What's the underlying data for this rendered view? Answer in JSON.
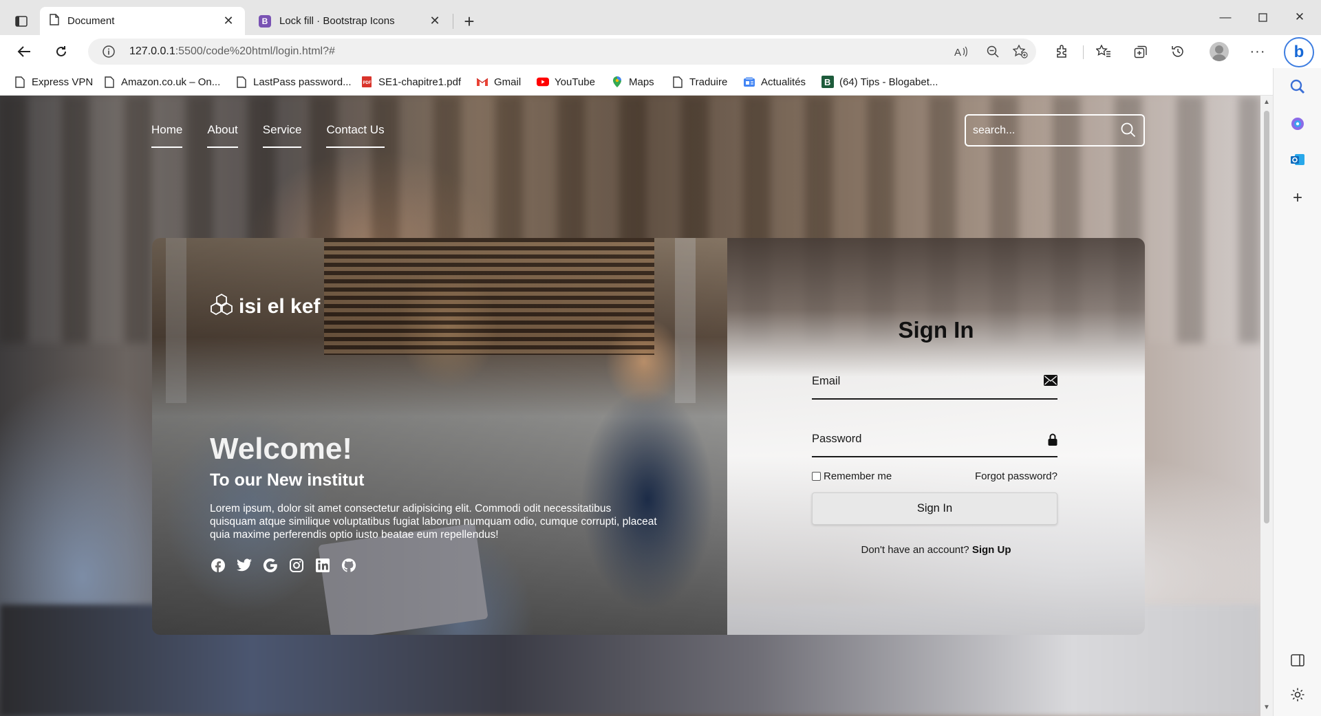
{
  "browser": {
    "tabs": [
      {
        "title": "Document",
        "active": true
      },
      {
        "title": "Lock fill · Bootstrap Icons",
        "active": false,
        "favicon_letter": "B"
      }
    ],
    "url": {
      "host": "127.0.0.1",
      "path": ":5500/code%20html/login.html?#"
    },
    "bookmarks": [
      {
        "label": "Express VPN",
        "icon": "page-icon"
      },
      {
        "label": "Amazon.co.uk – On...",
        "icon": "page-icon"
      },
      {
        "label": "LastPass password...",
        "icon": "page-icon"
      },
      {
        "label": "SE1-chapitre1.pdf",
        "icon": "pdf-icon"
      },
      {
        "label": "Gmail",
        "icon": "gmail-icon"
      },
      {
        "label": "YouTube",
        "icon": "youtube-icon"
      },
      {
        "label": "Maps",
        "icon": "maps-icon"
      },
      {
        "label": "Traduire",
        "icon": "page-icon"
      },
      {
        "label": "Actualités",
        "icon": "news-icon"
      },
      {
        "label": "(64) Tips - Blogabet...",
        "icon": "blogabet-icon"
      }
    ]
  },
  "page": {
    "nav": [
      "Home",
      "About",
      "Service",
      "Contact Us"
    ],
    "search_placeholder": "search...",
    "brand": "isi el kef",
    "welcome": "Welcome!",
    "subtitle": "To our New institut",
    "lorem": "Lorem ipsum, dolor sit amet consectetur adipisicing elit. Commodi odit necessitatibus quisquam atque similique voluptatibus fugiat laborum numquam odio, cumque corrupti, placeat quia maxime perferendis optio iusto beatae eum repellendus!",
    "socials": [
      "facebook-icon",
      "twitter-icon",
      "google-icon",
      "instagram-icon",
      "linkedin-icon",
      "github-icon"
    ],
    "form": {
      "title": "Sign In",
      "email_label": "Email",
      "password_label": "Password",
      "remember": "Remember me",
      "forgot": "Forgot password?",
      "button": "Sign In",
      "no_account": "Don't have an account?",
      "signup": "Sign Up"
    }
  }
}
